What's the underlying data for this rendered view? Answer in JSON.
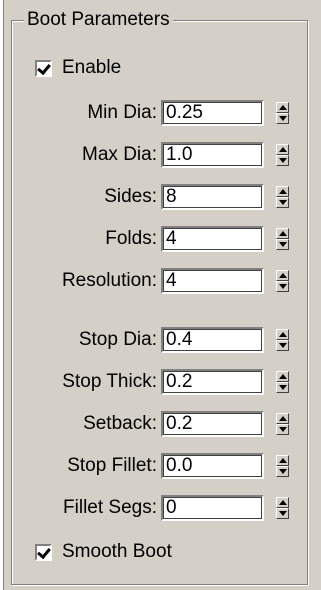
{
  "group": {
    "title": "Boot Parameters"
  },
  "enable": {
    "label": "Enable",
    "checked": true
  },
  "params": [
    {
      "label": "Min Dia:",
      "value": "0.25"
    },
    {
      "label": "Max Dia:",
      "value": "1.0"
    },
    {
      "label": "Sides:",
      "value": "8"
    },
    {
      "label": "Folds:",
      "value": "4"
    },
    {
      "label": "Resolution:",
      "value": "4"
    },
    {
      "label": "Stop Dia:",
      "value": "0.4"
    },
    {
      "label": "Stop Thick:",
      "value": "0.2"
    },
    {
      "label": "Setback:",
      "value": "0.2"
    },
    {
      "label": "Stop Fillet:",
      "value": "0.0"
    },
    {
      "label": "Fillet Segs:",
      "value": "0"
    }
  ],
  "smooth": {
    "label": "Smooth Boot",
    "checked": true
  },
  "colors": {
    "panel_bg": "#d4d0c8",
    "field_bg": "#ffffff",
    "border_dark": "#808080",
    "border_light": "#ffffff"
  }
}
